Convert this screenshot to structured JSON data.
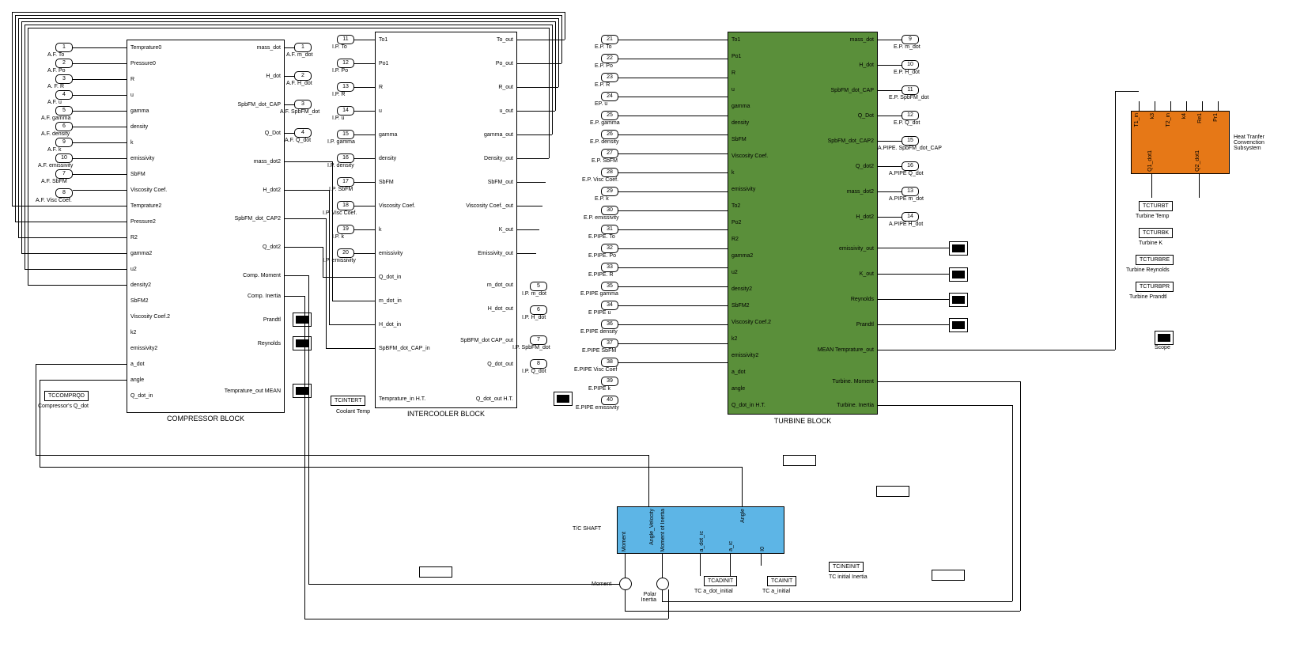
{
  "compressor": {
    "title": "COMPRESSOR BLOCK",
    "inputs": [
      "Temprature0",
      "Pressure0",
      "R",
      "u",
      "gamma",
      "density",
      "k",
      "emissivity",
      "SbFM",
      "Viscosity Coef.",
      "Temprature2",
      "Pressure2",
      "R2",
      "gamma2",
      "u2",
      "density2",
      "SbFM2",
      "Viscosity Coef.2",
      "k2",
      "emissivity2",
      "a_dot",
      "angle",
      "Q_dot_in"
    ],
    "outputs": [
      "mass_dot",
      "H_dot",
      "SpbFM_dot_CAP",
      "Q_Dot",
      "mass_dot2",
      "H_dot2",
      "SpbFM_dot_CAP2",
      "Q_dot2",
      "Comp. Moment",
      "Comp. Inertia",
      "Prandtl",
      "Reynolds",
      "Temprature_out MEAN"
    ]
  },
  "intercooler": {
    "title": "INTERCOOLER BLOCK",
    "inputs": [
      "To1",
      "Po1",
      "R",
      "u",
      "gamma",
      "density",
      "SbFM",
      "Viscosity Coef.",
      "k",
      "emissivity",
      "Q_dot_in",
      "m_dot_in",
      "H_dot_in",
      "SpBFM_dot_CAP_in",
      "Temprature_in  H.T.",
      "Coolant Temp"
    ],
    "outputs": [
      "To_out",
      "Po_out",
      "R_out",
      "u_out",
      "gamma_out",
      "Density_out",
      "SbFM_out",
      "Viscosity Coef._out",
      "K_out",
      "Emissivity_out",
      "m_dot_out",
      "H_dot_out",
      "SpBFM_dot CAP_out",
      "Q_dot_out",
      "Q_dot_out  H.T."
    ]
  },
  "turbine": {
    "title": "TURBINE BLOCK",
    "inputs": [
      "To1",
      "Po1",
      "R",
      "u",
      "gamma",
      "density",
      "SbFM",
      "Viscosity Coef.",
      "k",
      "emissivity",
      "To2",
      "Po2",
      "R2",
      "gamma2",
      "u2",
      "density2",
      "SbFM2",
      "Viscosity Coef.2",
      "k2",
      "emissivity2",
      "a_dot",
      "angle",
      "Q_dot_in H.T."
    ],
    "outputs": [
      "mass_dot",
      "H_dot",
      "SpbFM_dot_CAP",
      "Q_Dot",
      "SpbFM_dot_CAP2",
      "Q_dot2",
      "mass_dot2",
      "H_dot2",
      "emissivity_out",
      "K_out",
      "Reynolds",
      "Prandtl",
      "MEAN  Temprature_out",
      "Turbine. Moment",
      "Turbine. Inertia"
    ]
  },
  "heat": {
    "title": "Heat Tranfer Convenction Subsystem",
    "inputs_top": [
      "T1_in",
      "k3",
      "T2_in",
      "k4",
      "Re1",
      "Pr1"
    ],
    "outputs_bottom": [
      "Q1_dot1",
      "Q2_dot1"
    ]
  },
  "tcshaft": {
    "title": "T/C SHAFT",
    "outputs_top": [
      "Angle_Velocity",
      "Angle"
    ],
    "inputs_bottom": [
      "Moment",
      "Moment of Inertia",
      "a_dot_ic",
      "a_ic",
      "I0"
    ]
  },
  "af_inports": [
    {
      "num": "1",
      "label": "A.F. To"
    },
    {
      "num": "2",
      "label": "A.F. Po"
    },
    {
      "num": "3",
      "label": "A. F. R"
    },
    {
      "num": "4",
      "label": "A.F. u"
    },
    {
      "num": "5",
      "label": "A.F. gamma"
    },
    {
      "num": "6",
      "label": "A.F. density"
    },
    {
      "num": "9",
      "label": "A.F. k"
    },
    {
      "num": "10",
      "label": "A.F. emissivity"
    },
    {
      "num": "7",
      "label": "A.F. SbFM"
    },
    {
      "num": "8",
      "label": "A.F. Visc Coef."
    }
  ],
  "af_outports": [
    {
      "num": "1",
      "label": "A.F. m_dot"
    },
    {
      "num": "2",
      "label": "A.F. H_dot"
    },
    {
      "num": "3",
      "label": "A.F. SpbFM_dot"
    },
    {
      "num": "4",
      "label": "A.F. Q_dot"
    }
  ],
  "ip_inports": [
    {
      "num": "11",
      "label": "I.P. To"
    },
    {
      "num": "12",
      "label": "I.P. Po"
    },
    {
      "num": "13",
      "label": "I.P. R"
    },
    {
      "num": "14",
      "label": "I.P. u"
    },
    {
      "num": "15",
      "label": "I.P. gamma"
    },
    {
      "num": "16",
      "label": "I.P. density"
    },
    {
      "num": "17",
      "label": "I.P. SbFM"
    },
    {
      "num": "18",
      "label": "I.P. Visc Coef."
    },
    {
      "num": "19",
      "label": "I.P. k"
    },
    {
      "num": "20",
      "label": "I.P. emissivity"
    }
  ],
  "ip_outports": [
    {
      "num": "5",
      "label": "I.P. m_dot"
    },
    {
      "num": "6",
      "label": "I.P. H_dot"
    },
    {
      "num": "7",
      "label": "I.P. SpbFM_dot"
    },
    {
      "num": "8",
      "label": "I.P. Q_dot"
    }
  ],
  "ep_inports": [
    {
      "num": "21",
      "label": "E.P. To"
    },
    {
      "num": "22",
      "label": "E.P. Po"
    },
    {
      "num": "23",
      "label": "E.P. R"
    },
    {
      "num": "24",
      "label": "EP. u"
    },
    {
      "num": "25",
      "label": "E.P. gamma"
    },
    {
      "num": "26",
      "label": "E.P. density"
    },
    {
      "num": "27",
      "label": "E.P. SbFM"
    },
    {
      "num": "28",
      "label": "E.P. Visc Coef."
    },
    {
      "num": "29",
      "label": "E.P. k"
    },
    {
      "num": "30",
      "label": "E.P. emissivity"
    }
  ],
  "epipe_inports": [
    {
      "num": "31",
      "label": "E.PIPE. To"
    },
    {
      "num": "32",
      "label": "E.PIPE. Po"
    },
    {
      "num": "33",
      "label": "E.PIPE. R"
    },
    {
      "num": "35",
      "label": "E.PIPE gamma"
    },
    {
      "num": "34",
      "label": "E PIPE u"
    },
    {
      "num": "36",
      "label": "E.PIPE density"
    },
    {
      "num": "37",
      "label": "E.PIPE SbFM"
    },
    {
      "num": "38",
      "label": "E.PIPE Visc Coef"
    },
    {
      "num": "39",
      "label": "E.PIPE k"
    },
    {
      "num": "40",
      "label": "E.PIPE emissivity"
    }
  ],
  "ep_outports": [
    {
      "num": "9",
      "label": "E.P. m_dot"
    },
    {
      "num": "10",
      "label": "E.P. H_dot"
    },
    {
      "num": "11",
      "label": "E.P. SpbFM_dot"
    },
    {
      "num": "12",
      "label": "E.P. Q_dot"
    }
  ],
  "apipe_outports": [
    {
      "num": "15",
      "label": "A.PIPE. SpbFM_dot_CAP"
    },
    {
      "num": "16",
      "label": "A.PIPE Q_dot"
    },
    {
      "num": "13",
      "label": "A.PIPE m_dot"
    },
    {
      "num": "14",
      "label": "A.PIPE H_dot"
    }
  ],
  "constants": {
    "tccomprod": {
      "value": "TCCOMPRQD",
      "label": "Compressor's Q_dot"
    },
    "tcintert": {
      "value": "TCINTERT",
      "label": "Coolant Temp"
    },
    "tcadinit": {
      "value": "TCADINIT",
      "label": "TC a_dot_initial"
    },
    "tcainit": {
      "value": "TCAINIT",
      "label": "TC a_initial"
    },
    "tcineinit": {
      "value": "TCINEINIT",
      "label": "TC initial Inertia"
    },
    "tcturbt": {
      "value": "TCTURBT",
      "label": "Turbine Temp"
    },
    "tcturbk": {
      "value": "TCTURBK",
      "label": "Turbine K"
    },
    "tcturbre": {
      "value": "TCTURBRE",
      "label": "Turbine Reynolds"
    },
    "tcturbpr": {
      "value": "TCTURBPR",
      "label": "Turbine Prandtl"
    }
  },
  "labels": {
    "moment": "Moment",
    "polar_inertia": "Polar Inertia",
    "scope": "Scope"
  }
}
